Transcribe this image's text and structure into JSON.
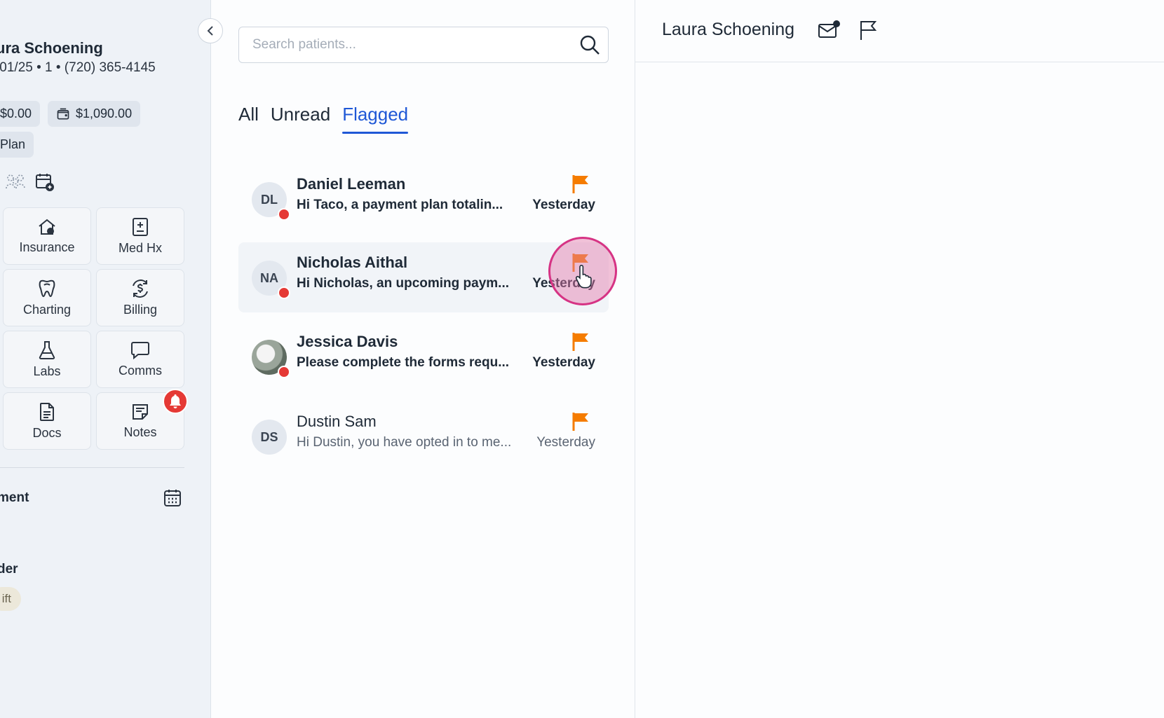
{
  "sidebar": {
    "patient_name": "ura Schoening",
    "patient_sub": "/01/25 • 1 • (720) 365-4145",
    "balance_1": "$0.00",
    "balance_2": "$1,090.00",
    "plan_chip": "Plan",
    "tiles": [
      {
        "label": "Insurance",
        "icon": "house-dollar-icon"
      },
      {
        "label": "Med Hx",
        "icon": "medical-history-icon"
      },
      {
        "label": "Charting",
        "icon": "tooth-icon"
      },
      {
        "label": "Billing",
        "icon": "billing-dollar-icon"
      },
      {
        "label": "Labs",
        "icon": "flask-icon"
      },
      {
        "label": "Comms",
        "icon": "chat-bubble-icon"
      },
      {
        "label": "Docs",
        "icon": "document-icon"
      },
      {
        "label": "Notes",
        "icon": "notes-icon"
      }
    ],
    "section_appointment": "ment",
    "section_provider": "der",
    "pill_text": "ift"
  },
  "search": {
    "placeholder": "Search patients..."
  },
  "tabs": [
    {
      "label": "All",
      "active": false
    },
    {
      "label": "Unread",
      "active": false
    },
    {
      "label": "Flagged",
      "active": true
    }
  ],
  "conversations": [
    {
      "initials": "DL",
      "name": "Daniel Leeman",
      "preview": "Hi Taco, a payment plan totalin...",
      "time": "Yesterday",
      "unread": true,
      "flagged": true
    },
    {
      "initials": "NA",
      "name": "Nicholas Aithal",
      "preview": "Hi Nicholas, an upcoming paym...",
      "time": "Yesterday",
      "unread": true,
      "flagged": true
    },
    {
      "initials": "",
      "name": "Jessica Davis",
      "preview": "Please complete the forms requ...",
      "time": "Yesterday",
      "unread": true,
      "flagged": true
    },
    {
      "initials": "DS",
      "name": "Dustin Sam",
      "preview": "Hi Dustin, you have opted in to me...",
      "time": "Yesterday",
      "unread": false,
      "flagged": true
    }
  ],
  "detail": {
    "patient_name": "Laura Schoening"
  },
  "colors": {
    "accent": "#1f58d6",
    "flag": "#f57c00",
    "unread_dot": "#e53935",
    "notification": "#e53935"
  }
}
